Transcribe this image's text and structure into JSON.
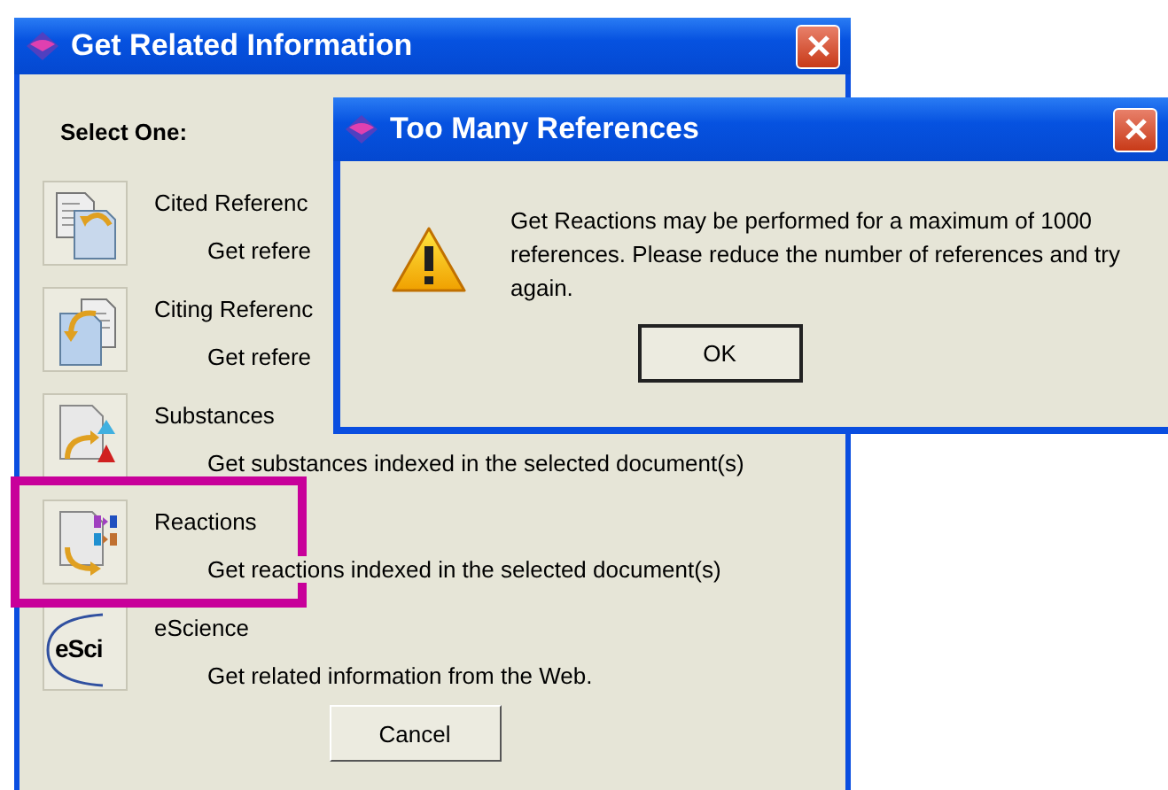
{
  "window": {
    "title": "Get Related Information"
  },
  "prompt": "Select One:",
  "options": [
    {
      "kind": "cited",
      "title": "Cited Referenc",
      "description": "Get refere"
    },
    {
      "kind": "citing",
      "title": "Citing Referenc",
      "description": "Get refere"
    },
    {
      "kind": "substances",
      "title": "Substances",
      "description": "Get substances indexed in the selected document(s)"
    },
    {
      "kind": "reactions",
      "title": "Reactions",
      "description": "Get reactions indexed in the selected document(s)",
      "highlighted": true
    },
    {
      "kind": "escience",
      "title": "eScience",
      "description": "Get related information from the Web.",
      "icon_text": "eSci"
    }
  ],
  "cancel_button": "Cancel",
  "dialog": {
    "title": "Too Many References",
    "message": "Get Reactions may be performed for a maximum of 1000 references. Please reduce the number of references and try again.",
    "button": "OK"
  }
}
